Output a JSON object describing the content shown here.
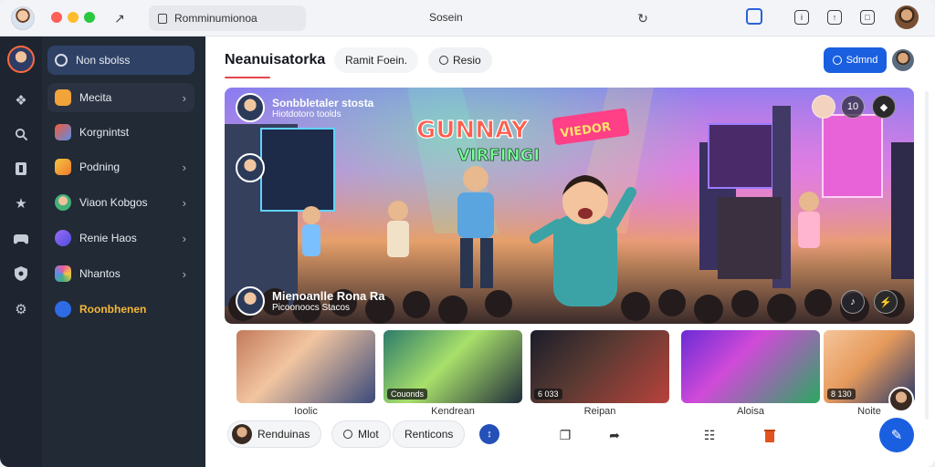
{
  "topbar": {
    "url_text": "Romminumionoa",
    "center_title": "Sosein"
  },
  "sidebar": {
    "items": [
      {
        "label": "Non sbolss",
        "icon": "home-icon",
        "color": "#3e5a8c"
      },
      {
        "label": "Mecita",
        "icon": "grid-icon",
        "color": "#f2a33a"
      },
      {
        "label": "Korgnintst",
        "icon": "tag-icon",
        "color": "#5b8de8"
      },
      {
        "label": "Podning",
        "icon": "folder-icon",
        "color": "#f39a2c"
      },
      {
        "label": "Viaon Kobgos",
        "icon": "user-icon",
        "color": "#44b07a"
      },
      {
        "label": "Renie Haos",
        "icon": "sparkle-icon",
        "color": "#7a5cf0"
      },
      {
        "label": "Nhantos",
        "icon": "palette-icon",
        "color": "#e85c9c"
      },
      {
        "label": "Roonbhenen",
        "icon": "shield-icon",
        "color": "#2e6ce6"
      }
    ]
  },
  "header": {
    "title": "Neanuisatorka",
    "tab_1": "Ramit Foein.",
    "tab_2": "Resio",
    "primary_button": "Sdmnd"
  },
  "hero": {
    "top_title": "Sonbbletaler stosta",
    "top_subtitle": "Hiotdotoro toolds",
    "banner_text": "GUNNAY",
    "banner_sub": "VIRFINGI",
    "sign_text": "VIEDOR",
    "bottom_title": "Mienoanlle Rona  Ra",
    "bottom_subtitle": "Picoonoocs Stacos",
    "badge_count": "10"
  },
  "thumbnails": [
    {
      "label": "Ioolic",
      "badge": ""
    },
    {
      "label": "Kendrean",
      "badge": "Couonds"
    },
    {
      "label": "Reipan",
      "badge": "6 033"
    },
    {
      "label": "Aloisa",
      "badge": ""
    },
    {
      "label": "Noite",
      "badge": "8 130"
    }
  ],
  "bottom_bar": {
    "chip_1": "Renduinas",
    "chip_2": "Mlot",
    "chip_3": "Renticons"
  }
}
